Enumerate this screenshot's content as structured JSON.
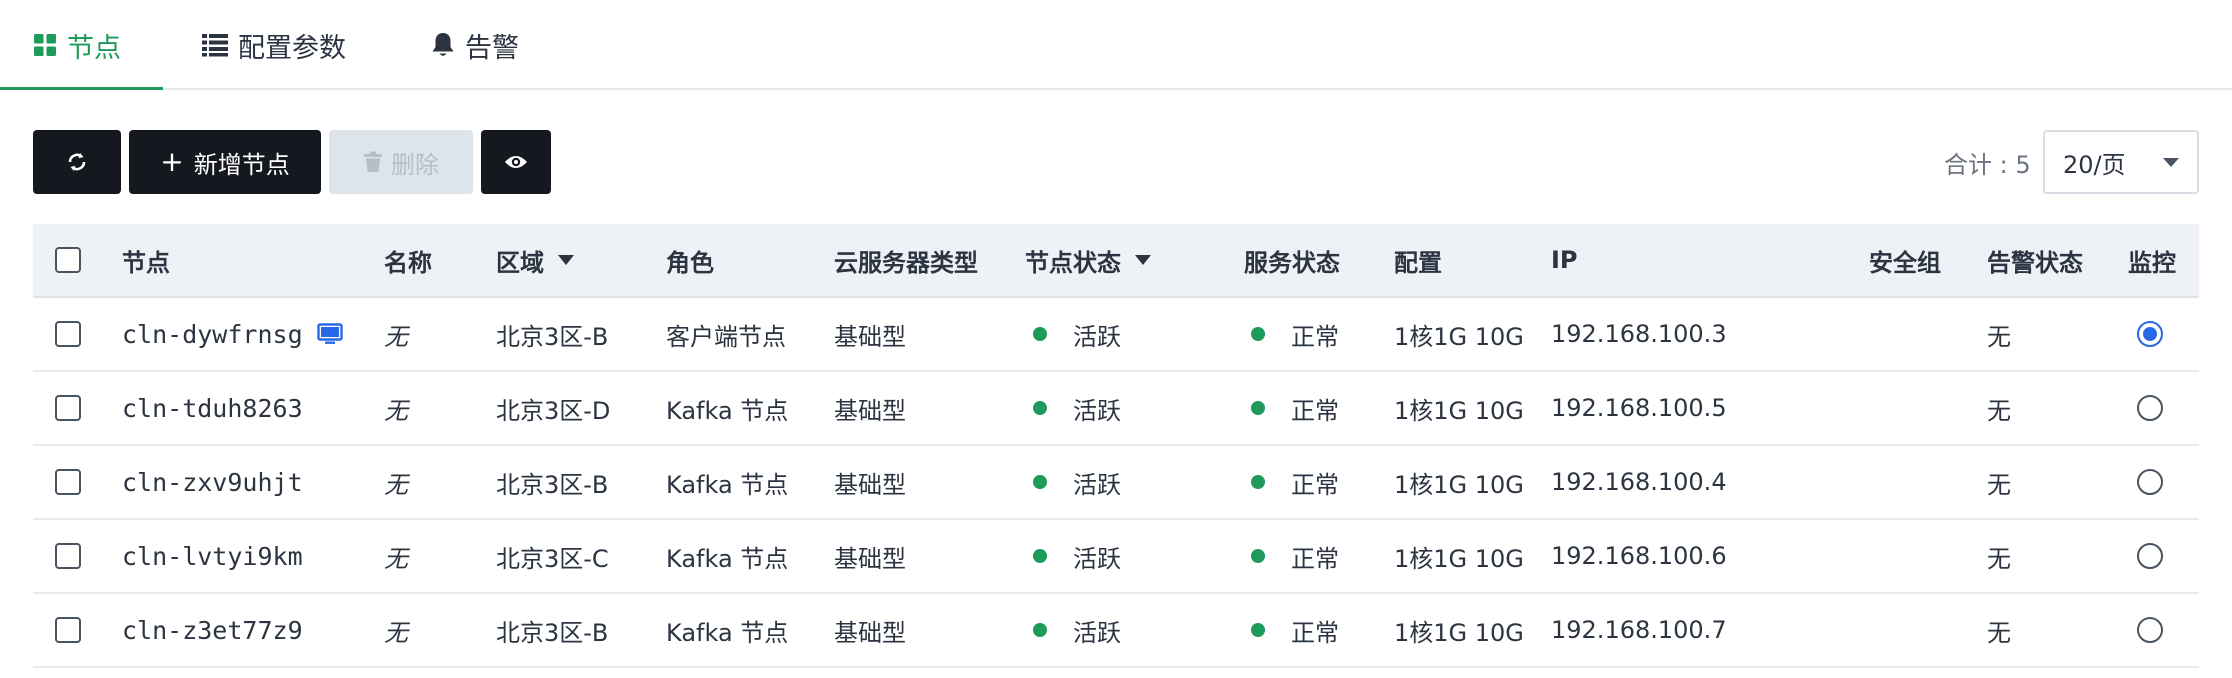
{
  "tabs": [
    {
      "label": "节点",
      "icon": "grid-icon",
      "active": true
    },
    {
      "label": "配置参数",
      "icon": "list-icon",
      "active": false
    },
    {
      "label": "告警",
      "icon": "bell-icon",
      "active": false
    }
  ],
  "toolbar": {
    "refresh_icon": "refresh-icon",
    "add_label": "新增节点",
    "add_prefix": "+",
    "delete_label": "删除",
    "view_icon": "eye-icon"
  },
  "summary": {
    "total_label": "合计 : 5",
    "page_size": "20/页"
  },
  "table": {
    "headers": {
      "node": "节点",
      "name": "名称",
      "zone": "区域",
      "role": "角色",
      "type": "云服务器类型",
      "node_status": "节点状态",
      "service_status": "服务状态",
      "config": "配置",
      "ip": "IP",
      "security_group": "安全组",
      "alarm_status": "告警状态",
      "monitor": "监控"
    },
    "rows": [
      {
        "node": "cln-dywfrnsg",
        "name": "无",
        "zone": "北京3区-B",
        "role": "客户端节点",
        "type": "基础型",
        "node_status": "活跃",
        "service_status": "正常",
        "config": "1核1G 10G",
        "ip": "192.168.100.3",
        "security_group": "",
        "alarm_status": "无",
        "monitor_selected": true
      },
      {
        "node": "cln-tduh8263",
        "name": "无",
        "zone": "北京3区-D",
        "role": "Kafka 节点",
        "type": "基础型",
        "node_status": "活跃",
        "service_status": "正常",
        "config": "1核1G 10G",
        "ip": "192.168.100.5",
        "security_group": "",
        "alarm_status": "无",
        "monitor_selected": false
      },
      {
        "node": "cln-zxv9uhjt",
        "name": "无",
        "zone": "北京3区-B",
        "role": "Kafka 节点",
        "type": "基础型",
        "node_status": "活跃",
        "service_status": "正常",
        "config": "1核1G 10G",
        "ip": "192.168.100.4",
        "security_group": "",
        "alarm_status": "无",
        "monitor_selected": false
      },
      {
        "node": "cln-lvtyi9km",
        "name": "无",
        "zone": "北京3区-C",
        "role": "Kafka 节点",
        "type": "基础型",
        "node_status": "活跃",
        "service_status": "正常",
        "config": "1核1G 10G",
        "ip": "192.168.100.6",
        "security_group": "",
        "alarm_status": "无",
        "monitor_selected": false
      },
      {
        "node": "cln-z3et77z9",
        "name": "无",
        "zone": "北京3区-B",
        "role": "Kafka 节点",
        "type": "基础型",
        "node_status": "活跃",
        "service_status": "正常",
        "config": "1核1G 10G",
        "ip": "192.168.100.7",
        "security_group": "",
        "alarm_status": "无",
        "monitor_selected": false
      }
    ]
  },
  "colors": {
    "accent": "#1e9b5a",
    "primary_button": "#15191f",
    "radio_selected": "#2868e8",
    "monitor_icon": "#2868e8"
  }
}
